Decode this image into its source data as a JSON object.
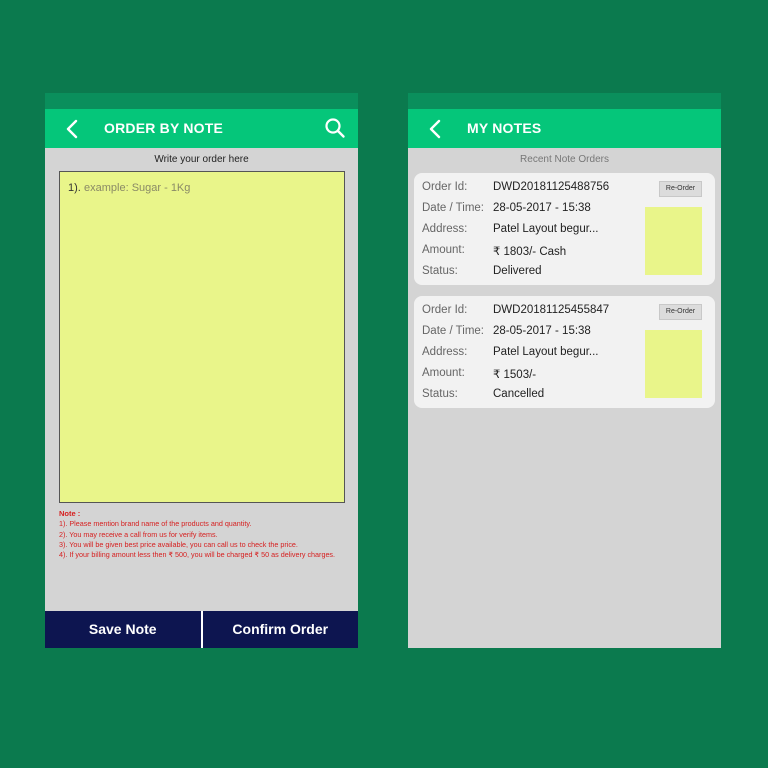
{
  "order_screen": {
    "title": "ORDER BY NOTE",
    "write_label": "Write your order here",
    "note_prefix": "1).",
    "note_placeholder": "example: Sugar - 1Kg",
    "notes_title": "Note :",
    "notes": [
      "1). Please mention brand name of the products and quantity.",
      "2). You may receive a call from us for verify items.",
      "3). You will be given best price available, you can call us to check the price.",
      "4). If your billing amount less then ₹ 500, you will be charged ₹ 50 as delivery charges."
    ],
    "save_label": "Save Note",
    "confirm_label": "Confirm Order"
  },
  "notes_screen": {
    "title": "MY NOTES",
    "section_label": "Recent Note Orders",
    "labels": {
      "order_id": "Order Id:",
      "date_time": "Date / Time:",
      "address": "Address:",
      "amount": "Amount:",
      "status": "Status:"
    },
    "reorder_label": "Re-Order",
    "orders": [
      {
        "order_id": "DWD20181125488756",
        "date_time": "28-05-2017 - 15:38",
        "address": "Patel Layout begur...",
        "amount": "₹ 1803/- Cash",
        "status": "Delivered"
      },
      {
        "order_id": "DWD20181125455847",
        "date_time": "28-05-2017 - 15:38",
        "address": "Patel Layout begur...",
        "amount": "₹ 1503/-",
        "status": "Cancelled"
      }
    ]
  },
  "colors": {
    "background": "#0b7a4e",
    "app_bar": "#05c67a",
    "status_bar": "#0a8f5c",
    "note_yellow": "#e9f58a",
    "bottom_bar": "#0d1550",
    "note_text_red": "#d62020"
  },
  "icons": {
    "back": "chevron-left-icon",
    "search": "search-icon"
  }
}
